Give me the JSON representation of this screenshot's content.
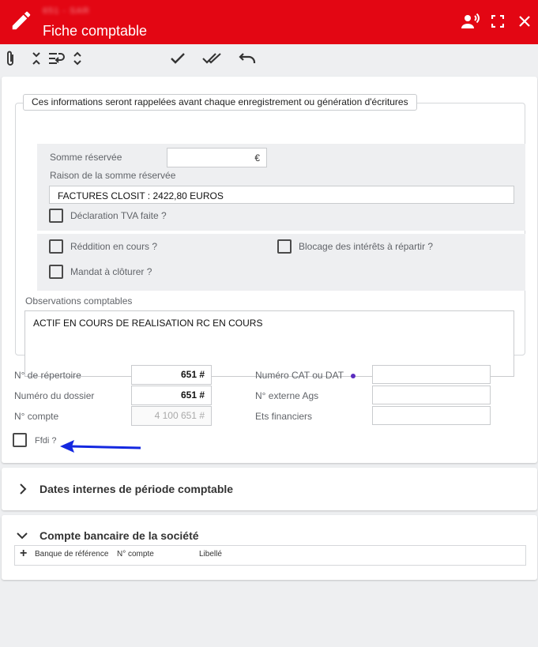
{
  "window": {
    "title": "Fiche comptable",
    "subtitle": "651 - SAR"
  },
  "toolbar": {
    "icons": [
      "paperclip-icon",
      "collapse-all-icon",
      "wrap-text-icon",
      "expand-all-icon",
      "check-icon",
      "double-check-icon",
      "undo-icon"
    ]
  },
  "info_box": {
    "legend": "Ces informations seront rappelées avant chaque enregistrement ou génération d'écritures",
    "somme_reservee_label": "Somme réservée",
    "somme_reservee_value": "",
    "somme_reservee_unit": "€",
    "raison_label": "Raison de la somme réservée",
    "raison_value": "FACTURES CLOSIT : 2422,80 EUROS",
    "declaration_tva_label": "Déclaration TVA faite ?",
    "declaration_tva_checked": false,
    "reddition_label": "Réddition en cours ?",
    "reddition_checked": false,
    "blocage_label": "Blocage des intérêts à répartir ?",
    "blocage_checked": false,
    "mandat_label": "Mandat à clôturer ?",
    "mandat_checked": false,
    "observations_label": "Observations comptables",
    "observations_value": "ACTIF EN COURS DE REALISATION RC EN COURS"
  },
  "fields": {
    "repertoire_label": "N° de répertoire",
    "repertoire_value": "651 #",
    "dossier_label": "Numéro du dossier",
    "dossier_value": "651 #",
    "compte_label": "N° compte",
    "compte_value": "4 100 651 #",
    "cat_dat_label": "Numéro CAT ou DAT",
    "cat_dat_value": "",
    "externe_label": "N° externe Ags",
    "externe_value": "",
    "ets_label": "Ets financiers",
    "ets_value": "",
    "ffdi_label": "Ffdi ?",
    "ffdi_checked": false
  },
  "sections": {
    "dates_title": "Dates internes de période comptable",
    "dates_expanded": false,
    "compte_bancaire_title": "Compte bancaire de la société",
    "compte_bancaire_expanded": true
  },
  "bank_table": {
    "add_symbol": "+",
    "columns": [
      "Banque de référence",
      "N° compte",
      "Libellé"
    ]
  },
  "colors": {
    "header": "#e30613",
    "annotation_arrow": "#1428e0",
    "info_dot": "#5b2dbf"
  }
}
